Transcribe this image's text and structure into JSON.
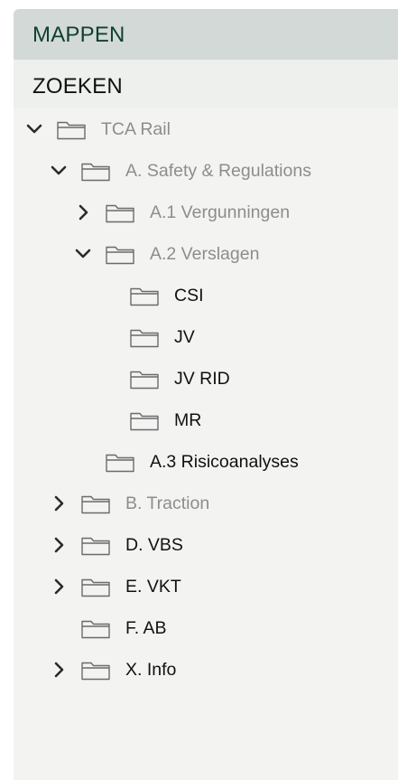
{
  "tabs": {
    "mappen": "MAPPEN",
    "zoeken": "ZOEKEN"
  },
  "tree": [
    {
      "label": "TCA Rail",
      "level": 0,
      "chevron": "down",
      "muted": true
    },
    {
      "label": "A. Safety & Regulations",
      "level": 1,
      "chevron": "down",
      "muted": true
    },
    {
      "label": "A.1 Vergunningen",
      "level": 2,
      "chevron": "right",
      "muted": true
    },
    {
      "label": "A.2 Verslagen",
      "level": 2,
      "chevron": "down",
      "muted": true
    },
    {
      "label": "CSI",
      "level": 3,
      "chevron": "none",
      "muted": false
    },
    {
      "label": "JV",
      "level": 3,
      "chevron": "none",
      "muted": false
    },
    {
      "label": "JV RID",
      "level": 3,
      "chevron": "none",
      "muted": false
    },
    {
      "label": "MR",
      "level": 3,
      "chevron": "none",
      "muted": false
    },
    {
      "label": "A.3 Risicoanalyses",
      "level": 2,
      "chevron": "none",
      "muted": false
    },
    {
      "label": "B. Traction",
      "level": 1,
      "chevron": "right",
      "muted": true
    },
    {
      "label": "D. VBS",
      "level": 1,
      "chevron": "right",
      "muted": false
    },
    {
      "label": "E. VKT",
      "level": 1,
      "chevron": "right",
      "muted": false
    },
    {
      "label": "F. AB",
      "level": 1,
      "chevron": "none",
      "muted": false
    },
    {
      "label": "X. Info",
      "level": 1,
      "chevron": "right",
      "muted": false
    }
  ],
  "icons": {
    "folder": "folder-icon",
    "expanded": "chevron-down-icon",
    "collapsed": "chevron-right-icon"
  },
  "colors": {
    "header_bg": "#d3d9d7",
    "header_text": "#0f3f32",
    "panel_bg": "#f3f3f2",
    "muted_text": "#8d8d8d"
  }
}
